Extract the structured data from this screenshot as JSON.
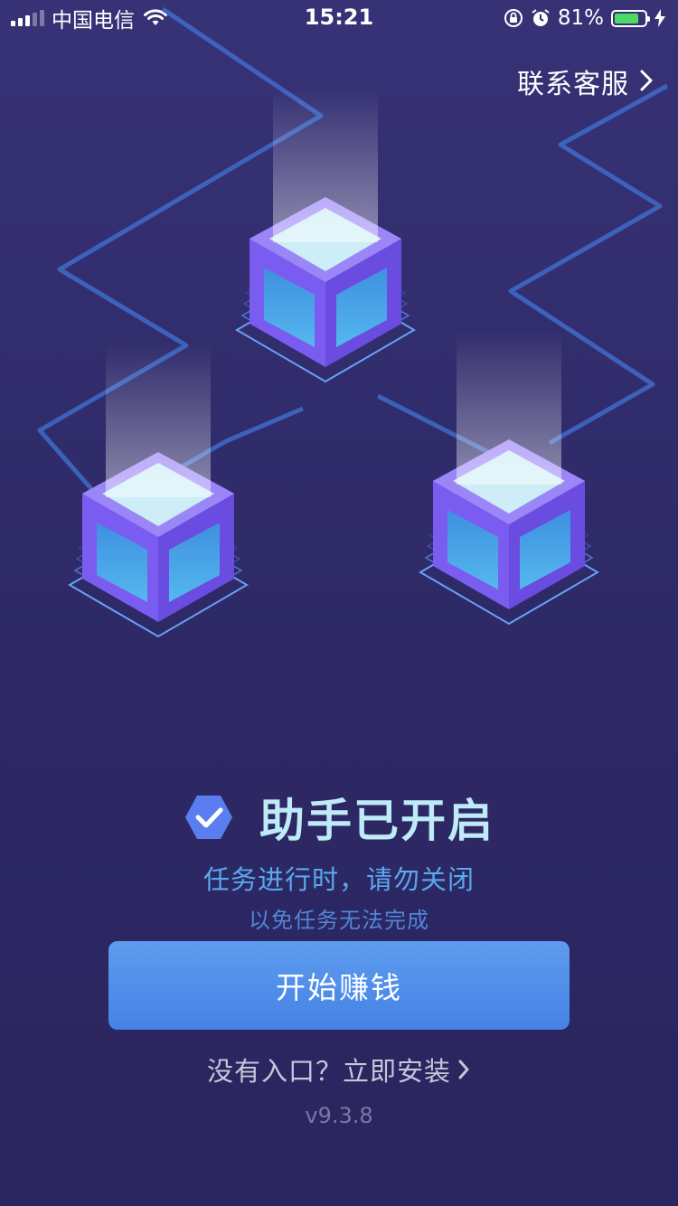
{
  "status_bar": {
    "carrier": "中国电信",
    "time": "15:21",
    "battery_percent": "81%",
    "battery_level": 0.81,
    "icons": [
      "signal-icon",
      "wifi-icon",
      "orientation-lock-icon",
      "alarm-icon",
      "battery-icon",
      "charging-bolt-icon"
    ]
  },
  "header": {
    "contact_label": "联系客服"
  },
  "status": {
    "title": "助手已开启",
    "icon": "hexagon-check-icon"
  },
  "message": {
    "line1": "任务进行时，请勿关闭",
    "line2": "以免任务无法完成"
  },
  "actions": {
    "start_label": "开始赚钱",
    "install_label": "没有入口？立即安装"
  },
  "footer": {
    "version": "v9.3.8"
  },
  "colors": {
    "background": "#2f2a68",
    "accent_blue": "#4a86e8",
    "title_cyan": "#bfeaf7",
    "cube_purple": "#7b5cf0"
  }
}
